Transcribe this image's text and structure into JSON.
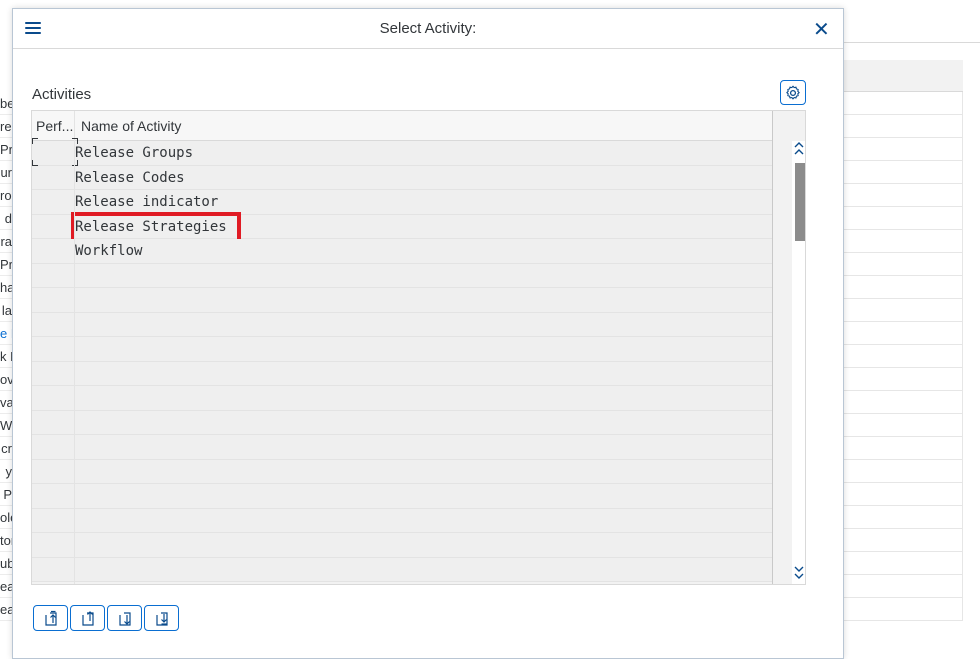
{
  "background": {
    "left_rows": [
      "be",
      "rec",
      "Pro",
      "ur",
      "roo",
      "d",
      "ra",
      "Pr",
      "ha",
      "la",
      "e F",
      "k R",
      "ova",
      "va",
      "W",
      "cr",
      "y",
      "P",
      "ole",
      "tor",
      "ub",
      "ea",
      "ea"
    ],
    "left_link_rows": [
      10
    ],
    "right_row_count": 23
  },
  "dialog": {
    "title": "Select Activity:",
    "menu_icon": "hamburger-menu-icon",
    "close_icon": "close-icon"
  },
  "section": {
    "title": "Activities",
    "settings_icon": "gear-icon"
  },
  "table": {
    "columns": [
      "Perf...",
      "Name of Activity"
    ],
    "rows": [
      {
        "name": "Release Groups"
      },
      {
        "name": "Release Codes"
      },
      {
        "name": "Release indicator"
      },
      {
        "name": "Release Strategies"
      },
      {
        "name": "Workflow"
      },
      {
        "name": ""
      },
      {
        "name": ""
      },
      {
        "name": ""
      },
      {
        "name": ""
      },
      {
        "name": ""
      },
      {
        "name": ""
      },
      {
        "name": ""
      },
      {
        "name": ""
      },
      {
        "name": ""
      },
      {
        "name": ""
      },
      {
        "name": ""
      },
      {
        "name": ""
      },
      {
        "name": ""
      }
    ],
    "highlighted_row": 3
  },
  "toolbar": {
    "buttons": [
      "scroll-first-page",
      "scroll-previous-page",
      "scroll-next-page",
      "scroll-last-page"
    ]
  },
  "colors": {
    "accent": "#0a6ed1",
    "highlight": "#e01b24"
  }
}
